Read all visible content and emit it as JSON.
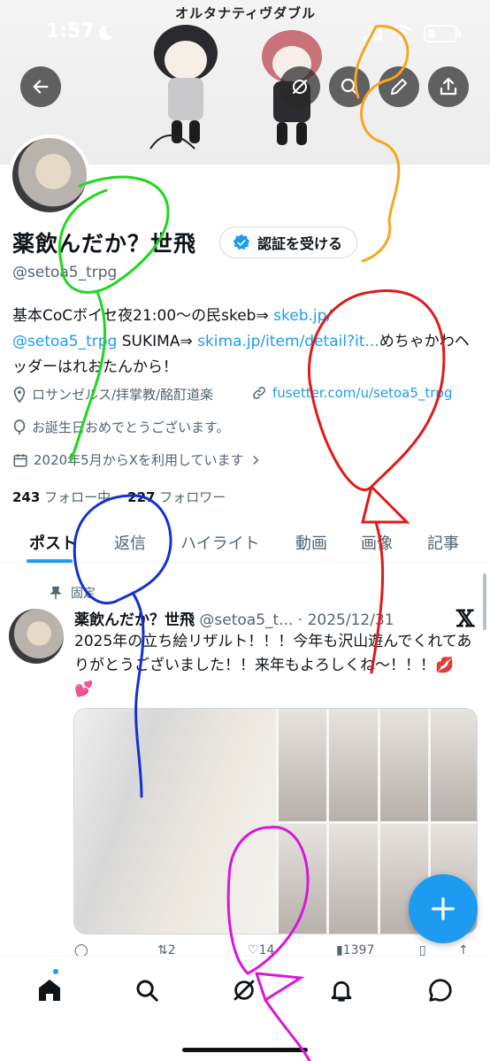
{
  "status_bar": {
    "time": "1:57"
  },
  "banner": {
    "title": "オルタナティヴダブル"
  },
  "header_buttons": [
    "back-icon",
    "no-grok-icon",
    "search-icon",
    "edit-icon",
    "share-icon"
  ],
  "profile": {
    "display_name": "薬飲んだか？世飛",
    "verify_label": "認証を受ける",
    "handle": "@setoa5_trpg",
    "bio_text_1": "基本CoCボイセ夜21:00～の民skeb⇒ ",
    "bio_link_1": "skeb.jp/",
    "bio_link_2": "@setoa5_trpg",
    "bio_text_2": " SUKIMA⇒ ",
    "bio_link_3": "skima.jp/item/detail?it...",
    "bio_text_3": "めちゃかわヘッダーはれおたんから！",
    "location": "ロサンゼルス/拝掌教/酩酊道楽",
    "website": "fusetter.com/u/setoa5_trpg",
    "birthday": "お誕生日おめでとうございます。",
    "joined": "2020年5月からXを利用しています",
    "following_count": "243",
    "following_label": " フォロー中",
    "followers_count": "227",
    "followers_label": " フォロワー"
  },
  "tabs": [
    {
      "label": "ポスト",
      "active": true
    },
    {
      "label": "返信",
      "active": false
    },
    {
      "label": "ハイライト",
      "active": false
    },
    {
      "label": "動画",
      "active": false
    },
    {
      "label": "画像",
      "active": false
    },
    {
      "label": "記事",
      "active": false
    }
  ],
  "tweet": {
    "pinned_label": "固定",
    "author_name": "薬飲んだか？世飛",
    "author_meta": " @setoa5_t... · 2025/12/31",
    "text": "2025年の立ち絵リザルト！！！今年も沢山遊んでくれてありがとうございました！！来年もよろしくね～！！！💋💕",
    "retweets": "2",
    "likes": "14",
    "views": "1397"
  },
  "bottom_nav": [
    "home-icon",
    "search-icon",
    "grok-icon",
    "bell-icon",
    "messages-icon"
  ],
  "colors": {
    "accent": "#1d9bf0",
    "text": "#0f1419",
    "secondary": "#536471"
  }
}
